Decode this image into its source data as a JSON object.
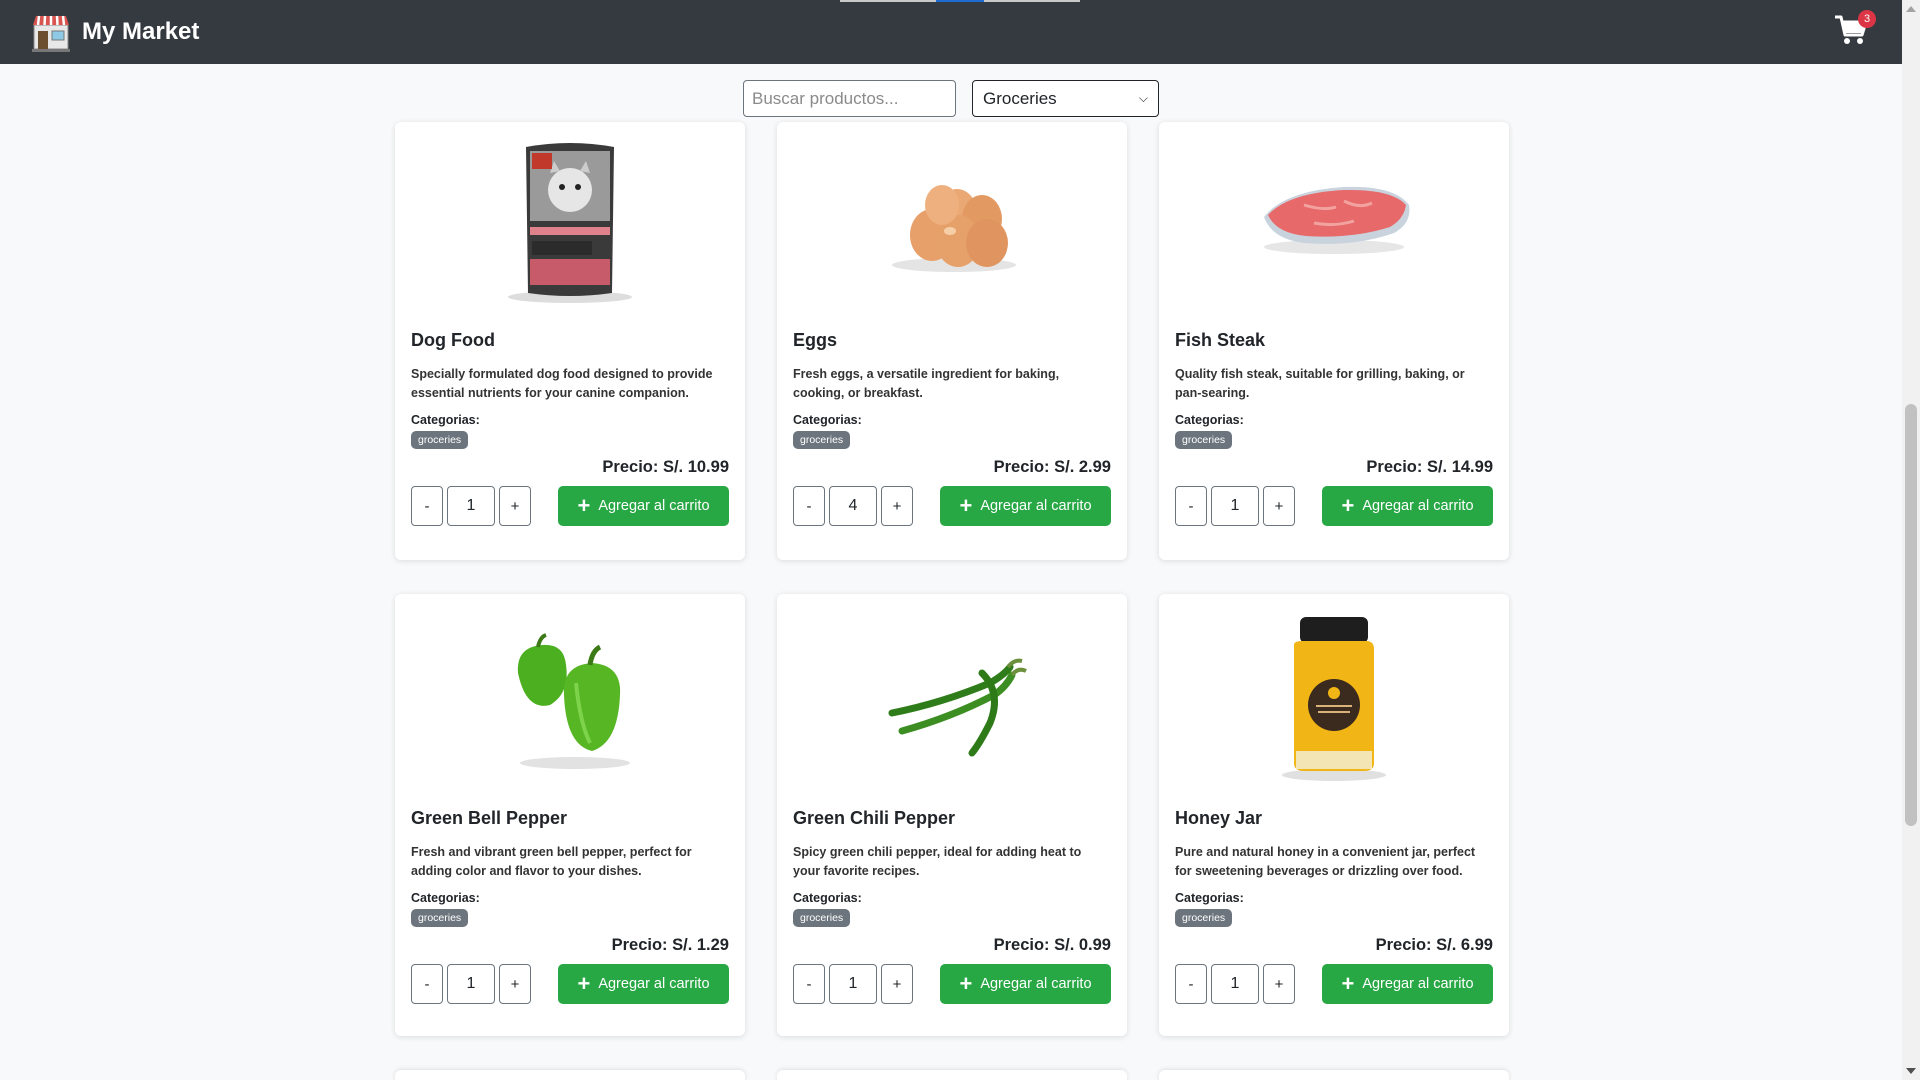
{
  "navbar": {
    "brand_name": "My Market",
    "cart_count": "3",
    "logo_icon": "storefront-icon",
    "cart_icon": "cart-icon",
    "bg_color": "#343a40"
  },
  "filters": {
    "search_placeholder": "Buscar productos...",
    "category_selected": "Groceries"
  },
  "labels": {
    "categories": "Categorias:",
    "add_to_cart": "Agregar al carrito",
    "minus": "-",
    "plus": "+"
  },
  "colors": {
    "accent_green": "#28a745",
    "badge_gray": "#6c757d"
  },
  "products": [
    {
      "name": "Dog Food",
      "description": "Specially formulated dog food designed to provide essential nutrients for your canine companion.",
      "category": "groceries",
      "price": "Precio: S/. 10.99",
      "quantity": "1",
      "image": "dog-food-bag"
    },
    {
      "name": "Eggs",
      "description": "Fresh eggs, a versatile ingredient for baking, cooking, or breakfast.",
      "category": "groceries",
      "price": "Precio: S/. 2.99",
      "quantity": "4",
      "image": "eggs"
    },
    {
      "name": "Fish Steak",
      "description": "Quality fish steak, suitable for grilling, baking, or pan-searing.",
      "category": "groceries",
      "price": "Precio: S/. 14.99",
      "quantity": "1",
      "image": "fish-steak"
    },
    {
      "name": "Green Bell Pepper",
      "description": "Fresh and vibrant green bell pepper, perfect for adding color and flavor to your dishes.",
      "category": "groceries",
      "price": "Precio: S/. 1.29",
      "quantity": "1",
      "image": "green-bell-pepper"
    },
    {
      "name": "Green Chili Pepper",
      "description": "Spicy green chili pepper, ideal for adding heat to your favorite recipes.",
      "category": "groceries",
      "price": "Precio: S/. 0.99",
      "quantity": "1",
      "image": "green-chili-pepper"
    },
    {
      "name": "Honey Jar",
      "description": "Pure and natural honey in a convenient jar, perfect for sweetening beverages or drizzling over food.",
      "category": "groceries",
      "price": "Precio: S/. 6.99",
      "quantity": "1",
      "image": "honey-jar"
    }
  ]
}
